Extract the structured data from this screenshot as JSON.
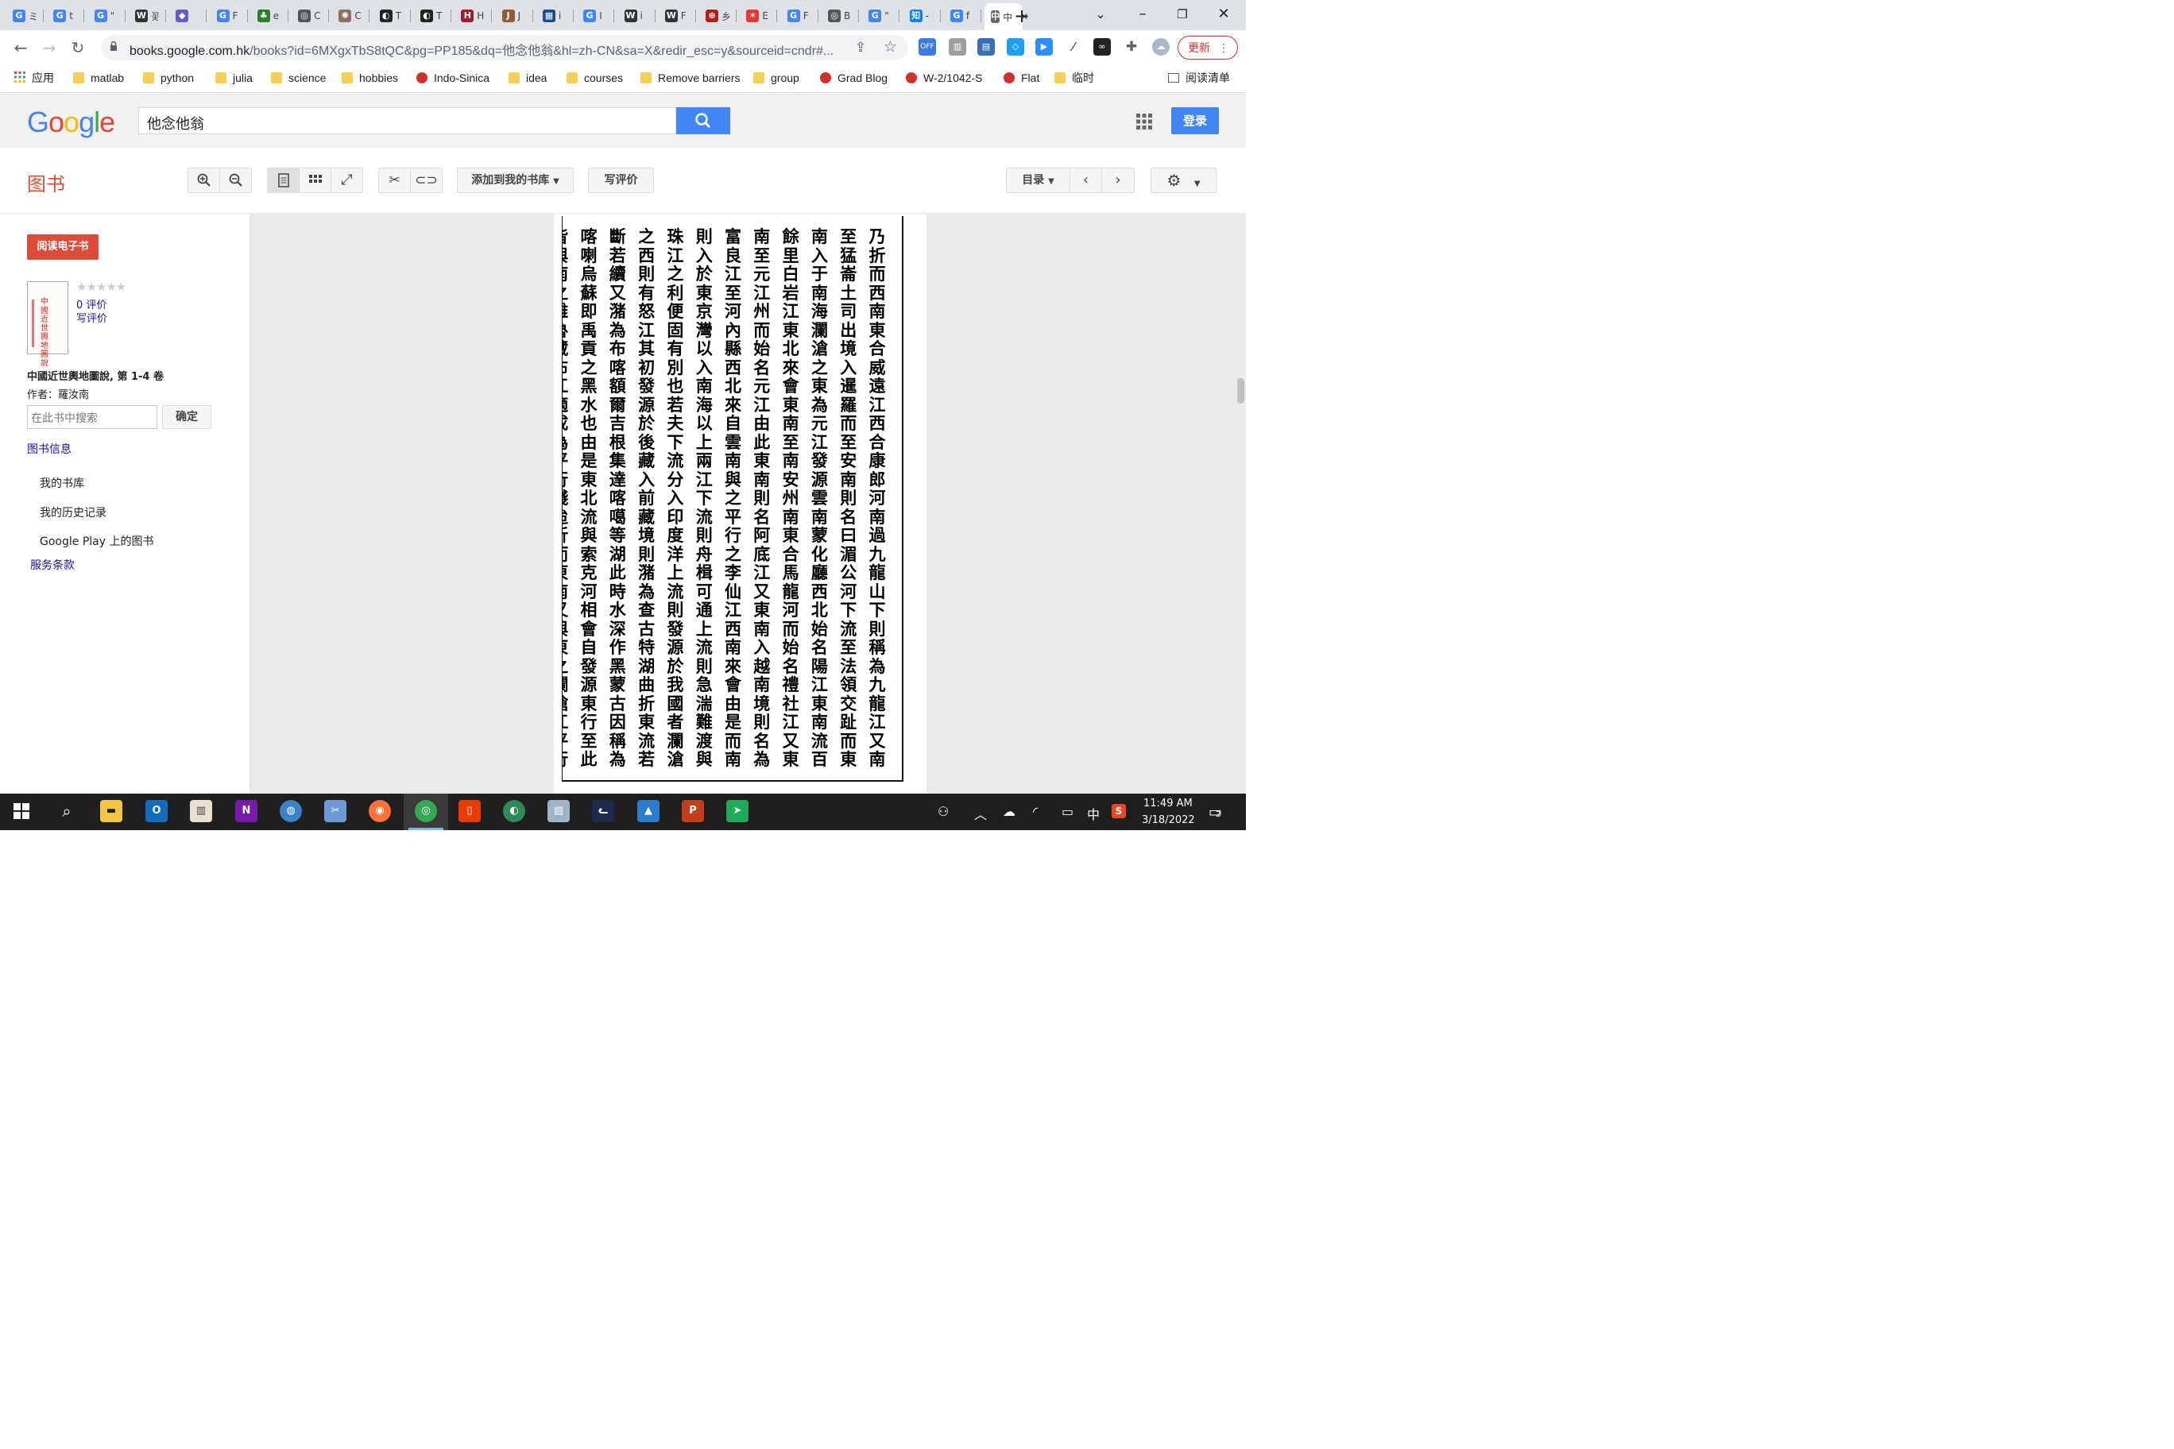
{
  "browser": {
    "tabs": [
      {
        "icon": "G",
        "color": "#4285f4",
        "label": "ミ"
      },
      {
        "icon": "G",
        "color": "#4285f4",
        "label": "t"
      },
      {
        "icon": "G",
        "color": "#4285f4",
        "label": "\""
      },
      {
        "icon": "W",
        "color": "#333333",
        "label": "꽃"
      },
      {
        "icon": "◆",
        "color": "#6a5acd",
        "label": ""
      },
      {
        "icon": "G",
        "color": "#4285f4",
        "label": "F"
      },
      {
        "icon": "♣",
        "color": "#2e7d32",
        "label": "e"
      },
      {
        "icon": "◎",
        "color": "#555555",
        "label": "C"
      },
      {
        "icon": "✺",
        "color": "#8d6e63",
        "label": "C"
      },
      {
        "icon": "◐",
        "color": "#222222",
        "label": "T"
      },
      {
        "icon": "◐",
        "color": "#222222",
        "label": "T"
      },
      {
        "icon": "H",
        "color": "#a51c30",
        "label": "H"
      },
      {
        "icon": "J",
        "color": "#8b5e34",
        "label": "J"
      },
      {
        "icon": "▦",
        "color": "#1a4c8b",
        "label": "i"
      },
      {
        "icon": "G",
        "color": "#4285f4",
        "label": "I"
      },
      {
        "icon": "W",
        "color": "#333333",
        "label": "i"
      },
      {
        "icon": "W",
        "color": "#333333",
        "label": "F"
      },
      {
        "icon": "⊕",
        "color": "#b71c1c",
        "label": "乡"
      },
      {
        "icon": "✶",
        "color": "#e53935",
        "label": "E"
      },
      {
        "icon": "G",
        "color": "#4285f4",
        "label": "F"
      },
      {
        "icon": "◎",
        "color": "#555555",
        "label": "B"
      },
      {
        "icon": "G",
        "color": "#4285f4",
        "label": "\""
      },
      {
        "icon": "知",
        "color": "#0084ff",
        "label": "-"
      },
      {
        "icon": "G",
        "color": "#4285f4",
        "label": "f"
      },
      {
        "icon": "中",
        "color": "#666666",
        "label": "中",
        "active": true
      }
    ],
    "url_domain": "books.google.com.hk",
    "url_rest": "/books?id=6MXgxTbS8tQC&pg=PP185&dq=他念他翁&hl=zh-CN&sa=X&redir_esc=y&sourceid=cndr#...",
    "update_label": "更新",
    "bookmarks": [
      {
        "label": "应用",
        "type": "apps"
      },
      {
        "label": "matlab",
        "type": "folder"
      },
      {
        "label": "python",
        "type": "folder"
      },
      {
        "label": "julia",
        "type": "folder"
      },
      {
        "label": "science",
        "type": "folder"
      },
      {
        "label": "hobbies",
        "type": "folder"
      },
      {
        "label": "Indo-Sinica",
        "type": "site"
      },
      {
        "label": "idea",
        "type": "folder"
      },
      {
        "label": "courses",
        "type": "folder"
      },
      {
        "label": "Remove barriers",
        "type": "folder"
      },
      {
        "label": "group",
        "type": "folder"
      },
      {
        "label": "Grad Blog",
        "type": "site"
      },
      {
        "label": "W-2/1042-S",
        "type": "site"
      },
      {
        "label": "Flat",
        "type": "site"
      },
      {
        "label": "临时",
        "type": "folder"
      }
    ],
    "reading_list": "阅读清单"
  },
  "google": {
    "logo": "Google",
    "search_value": "他念他翁",
    "login": "登录"
  },
  "books": {
    "section_title": "图书",
    "add_to_library": "添加到我的书库",
    "write_review": "写评价",
    "contents": "目录"
  },
  "sidebar": {
    "read_ebook": "阅读电子书",
    "stars": "★★★★★",
    "reviews_count": "0 评价",
    "write_review": "写评价",
    "book_title": "中國近世輿地圖說, 第 1-4 卷",
    "author": "作者：羅汝南",
    "search_placeholder": "在此书中搜索",
    "confirm": "确定",
    "book_info": "图书信息",
    "my_library": "我的书库",
    "history": "我的历史记录",
    "play_books": "Google Play 上的图书",
    "terms": "服务条款",
    "cover_text": "中國近世輿地圖說"
  },
  "page_text": {
    "columns": [
      "乃折而西南東合威遠江西合康郎河南過九龍山下則稱為九龍江又南",
      "至猛崙土司出境入暹羅而至安南則名曰湄公河下流至法領交趾而東",
      "南入于南海瀾滄之東為元江發源雲南蒙化廳西北始名陽江東南流百",
      "餘里白岩江東北來會東南至南安州南東合馬龍河而始名禮社江又東",
      "南至元江州而始名元江由此東南則名阿底江又東南入越南境則名為",
      "富良江至河內縣西北來自雲南與之平行之李仙江西南來會由是而南",
      "則入於東京灣以入南海以上兩江下流則舟楫可通上流則急湍難渡與",
      "珠江之利便固有別也若夫下流分入印度洋上流則發源於我國者瀾滄",
      "之西則有怒江其初發源於後藏入前藏境則潴為查古特湖曲折東流若",
      "斷若續又潴為布喀額爾吉根集達喀噶等湖此時水深作黑蒙古因稱為",
      "喀喇烏蘇即禹貢之黑水也由是東北流與索克河相會自發源東行至此",
      "皆與南之雅魯藏布江適成為平行綫迨折而東南又與東之瀾滄江平行"
    ]
  },
  "taskbar": {
    "time": "11:49 AM",
    "date": "3/18/2022",
    "ime": "中",
    "notifications": "2"
  }
}
